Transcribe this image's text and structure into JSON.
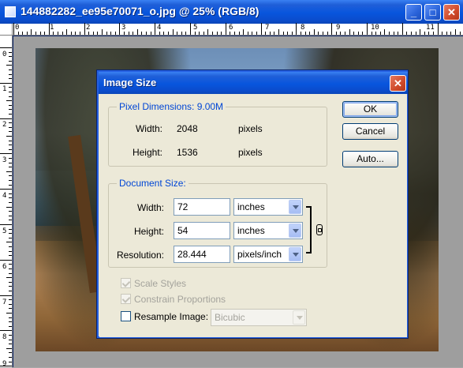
{
  "window": {
    "title": "144882282_ee95e70071_o.jpg @ 25% (RGB/8)",
    "buttons": {
      "minimize": "_",
      "maximize": "□",
      "close": "✕"
    }
  },
  "rulers": {
    "top_labels": [
      "0",
      "1",
      "2",
      "3",
      "4",
      "5",
      "6",
      "7",
      "8",
      "9",
      "10",
      "11"
    ],
    "left_labels": [
      "0",
      "1",
      "2",
      "3",
      "4",
      "5",
      "6",
      "7",
      "8",
      "9"
    ]
  },
  "dialog": {
    "title": "Image Size",
    "close_glyph": "✕",
    "pixel_dimensions": {
      "legend": "Pixel Dimensions:  9.00M",
      "width_label": "Width:",
      "width_value": "2048",
      "width_unit": "pixels",
      "height_label": "Height:",
      "height_value": "1536",
      "height_unit": "pixels"
    },
    "document_size": {
      "legend": "Document Size:",
      "width_label": "Width:",
      "width_value": "72",
      "width_unit": "inches",
      "height_label": "Height:",
      "height_value": "54",
      "height_unit": "inches",
      "resolution_label": "Resolution:",
      "resolution_value": "28.444",
      "resolution_unit": "pixels/inch"
    },
    "options": {
      "scale_styles": {
        "label": "Scale Styles",
        "checked": true,
        "enabled": false
      },
      "constrain_proportions": {
        "label": "Constrain Proportions",
        "checked": true,
        "enabled": false
      },
      "resample_image": {
        "label": "Resample Image:",
        "checked": false,
        "enabled": true
      },
      "resample_method": "Bicubic"
    },
    "buttons": {
      "ok": "OK",
      "cancel": "Cancel",
      "auto": "Auto..."
    }
  },
  "colors": {
    "titlebar": "#0855dd",
    "dialog_bg": "#ece9d8",
    "group_legend": "#0046d5"
  }
}
